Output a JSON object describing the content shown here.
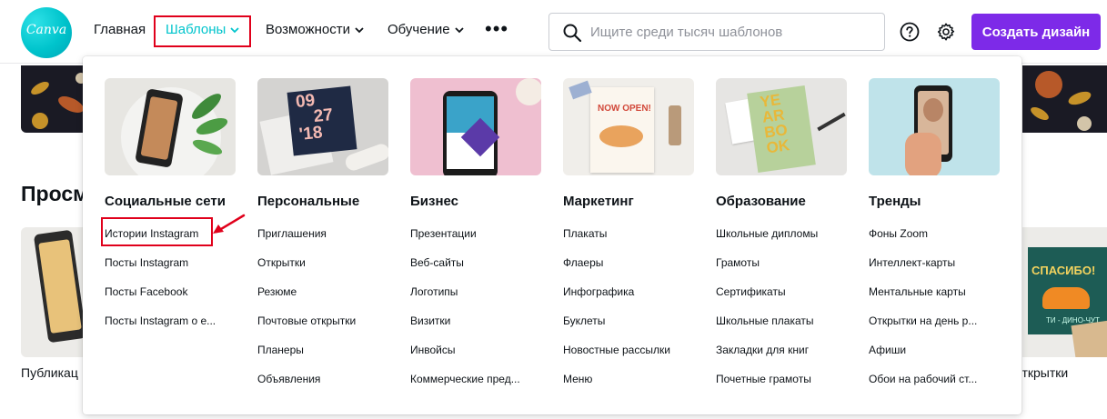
{
  "header": {
    "logo_text": "Canva",
    "nav": [
      {
        "label": "Главная",
        "dropdown": false,
        "active": false
      },
      {
        "label": "Шаблоны",
        "dropdown": true,
        "active": true
      },
      {
        "label": "Возможности",
        "dropdown": true,
        "active": false
      },
      {
        "label": "Обучение",
        "dropdown": true,
        "active": false
      }
    ],
    "more_icon": "more-horizontal-icon",
    "search_placeholder": "Ищите среди тысяч шаблонов",
    "search_value": "",
    "help_icon": "help-circle-icon",
    "settings_icon": "gear-icon",
    "create_button": "Создать дизайн",
    "colors": {
      "accent": "#00c4cc",
      "primary_button": "#7d2ae8",
      "highlight": "#e0001b"
    }
  },
  "background": {
    "section_heading": "Просм",
    "card_left_label": "Публикац",
    "card_right_label": "открытки",
    "card_right_postcard_title": "СПАСИБО!",
    "card_right_postcard_subtitle": "ТИ - ДИНО-ЧУТ"
  },
  "dropdown": {
    "columns": [
      {
        "title": "Социальные сети",
        "links": [
          "Истории Instagram",
          "Посты Instagram",
          "Посты Facebook",
          "Посты Instagram о е..."
        ]
      },
      {
        "title": "Персональные",
        "links": [
          "Приглашения",
          "Открытки",
          "Резюме",
          "Почтовые открытки",
          "Планеры",
          "Объявления"
        ]
      },
      {
        "title": "Бизнес",
        "links": [
          "Презентации",
          "Веб-сайты",
          "Логотипы",
          "Визитки",
          "Инвойсы",
          "Коммерческие пред..."
        ]
      },
      {
        "title": "Маркетинг",
        "links": [
          "Плакаты",
          "Флаеры",
          "Инфографика",
          "Буклеты",
          "Новостные рассылки",
          "Меню"
        ]
      },
      {
        "title": "Образование",
        "links": [
          "Школьные дипломы",
          "Грамоты",
          "Сертификаты",
          "Школьные плакаты",
          "Закладки для книг",
          "Почетные грамоты"
        ]
      },
      {
        "title": "Тренды",
        "links": [
          "Фоны Zoom",
          "Интеллект-карты",
          "Ментальные карты",
          "Открытки на день р...",
          "Афиши",
          "Обои на рабочий ст..."
        ]
      }
    ],
    "thumb_text": {
      "personal_date": [
        "09",
        "27",
        "'18"
      ],
      "marketing_poster": "NOW OPEN!",
      "education_yearbook": [
        "YE",
        "AR",
        "BO",
        "OK"
      ]
    },
    "highlighted_link": "Истории Instagram"
  }
}
